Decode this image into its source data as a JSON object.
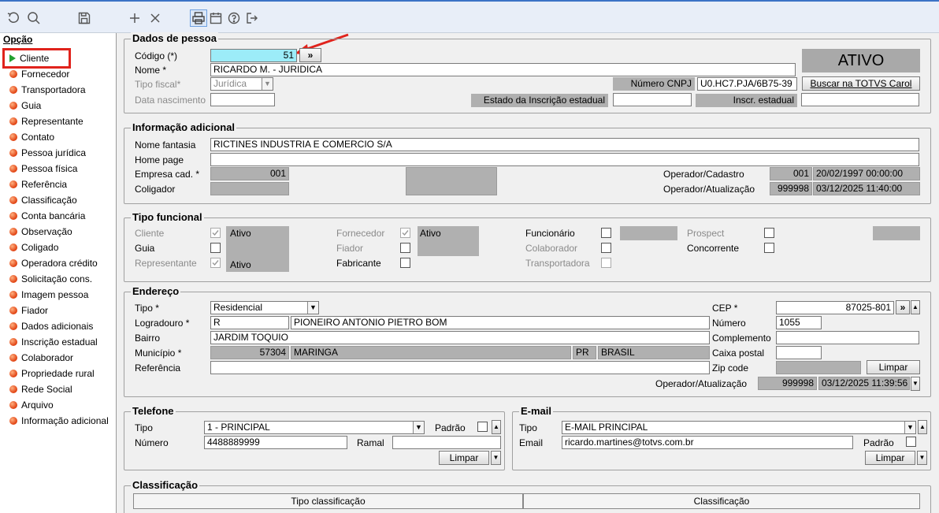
{
  "toolbar": {
    "icons": [
      "undo-icon",
      "search-icon",
      "save-icon",
      "add-icon",
      "close-icon",
      "print-icon",
      "calendar-icon",
      "help-icon",
      "exit-icon"
    ]
  },
  "sidebar": {
    "title": "Opção",
    "items": [
      "Cliente",
      "Fornecedor",
      "Transportadora",
      "Guia",
      "Representante",
      "Contato",
      "Pessoa jurídica",
      "Pessoa física",
      "Referência",
      "Classificação",
      "Conta bancária",
      "Observação",
      "Coligado",
      "Operadora crédito",
      "Solicitação cons.",
      "Imagem pessoa",
      "Fiador",
      "Dados adicionais",
      "Inscrição estadual",
      "Colaborador",
      "Propriedade rural",
      "Rede Social",
      "Arquivo",
      "Informação adicional"
    ]
  },
  "dados": {
    "title": "Dados de pessoa",
    "codigo_label": "Código (*)",
    "codigo_value": "51",
    "codigo_btn": "»",
    "nome_label": "Nome *",
    "nome_value": "RICARDO M. - JURIDICA",
    "tipo_fiscal_label": "Tipo fiscal*",
    "tipo_fiscal_value": "Jurídica",
    "data_nasc_label": "Data nascimento",
    "cnpj_label": "Número CNPJ",
    "cnpj_value": "U0.HC7.PJA/6B75-39",
    "status": "ATIVO",
    "buscar_btn": "Buscar na TOTVS Carol",
    "estado_ie_label": "Estado da Inscrição estadual",
    "inscr_label": "Inscr. estadual"
  },
  "info": {
    "title": "Informação adicional",
    "nome_fantasia_label": "Nome fantasia",
    "nome_fantasia_value": "RICTINES INDUSTRIA E COMERCIO S/A",
    "home_label": "Home page",
    "empresa_label": "Empresa cad. *",
    "empresa_value": "001",
    "coligador_label": "Coligador",
    "op_cad_label": "Operador/Cadastro",
    "op_cad_code": "001",
    "op_cad_date": "20/02/1997 00:00:00",
    "op_atu_label": "Operador/Atualização",
    "op_atu_code": "999998",
    "op_atu_date": "03/12/2025 11:40:00"
  },
  "tipo": {
    "title": "Tipo funcional",
    "cliente": "Cliente",
    "guia": "Guia",
    "representante": "Representante",
    "fornecedor": "Fornecedor",
    "fiador": "Fiador",
    "fabricante": "Fabricante",
    "funcionario": "Funcionário",
    "colaborador": "Colaborador",
    "transportadora": "Transportadora",
    "prospect": "Prospect",
    "concorrente": "Concorrente",
    "ativo": "Ativo"
  },
  "endereco": {
    "title": "Endereço",
    "tipo_label": "Tipo *",
    "tipo_value": "Residencial",
    "logradouro_label": "Logradouro *",
    "logradouro_tipo": "R",
    "logradouro_value": "PIONEIRO ANTONIO PIETRO BOM",
    "bairro_label": "Bairro",
    "bairro_value": "JARDIM TOQUIO",
    "municipio_label": "Município *",
    "municipio_code": "57304",
    "municipio_value": "MARINGA",
    "uf": "PR",
    "pais": "BRASIL",
    "referencia_label": "Referência",
    "cep_label": "CEP *",
    "cep_value": "87025-801",
    "cep_btn": "»",
    "numero_label": "Número",
    "numero_value": "1055",
    "complemento_label": "Complemento",
    "caixa_label": "Caixa postal",
    "zip_label": "Zip code",
    "limpar": "Limpar",
    "op_atu_label": "Operador/Atualização",
    "op_atu_code": "999998",
    "op_atu_date": "03/12/2025 11:39:56"
  },
  "telefone": {
    "title": "Telefone",
    "tipo_label": "Tipo",
    "tipo_value": "1 - PRINCIPAL",
    "padrao_label": "Padrão",
    "numero_label": "Número",
    "numero_value": "4488889999",
    "ramal_label": "Ramal",
    "limpar": "Limpar"
  },
  "email": {
    "title": "E-mail",
    "tipo_label": "Tipo",
    "tipo_value": "E-MAIL PRINCIPAL",
    "email_label": "Email",
    "email_value": "ricardo.martines@totvs.com.br",
    "padrao_label": "Padrão",
    "limpar": "Limpar"
  },
  "classificacao": {
    "title": "Classificação",
    "columns": [
      "Tipo classificação",
      "Classificação"
    ]
  },
  "colors": {
    "accent": "#3b73c6",
    "highlight": "#e0231c",
    "codigo_bg": "#9cecf8"
  }
}
